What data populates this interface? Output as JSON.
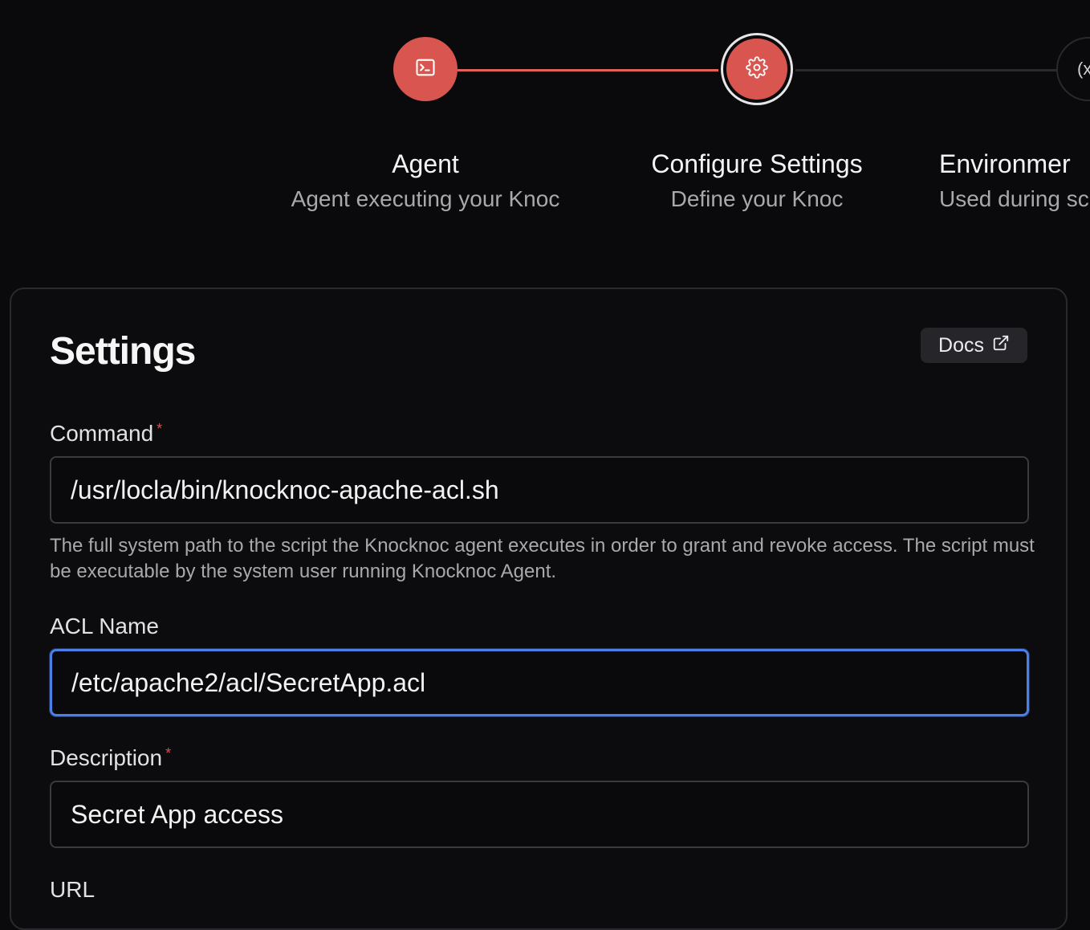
{
  "stepper": {
    "steps": [
      {
        "title": "Agent",
        "subtitle": "Agent executing your Knoc",
        "icon": "terminal-icon",
        "state": "completed"
      },
      {
        "title": "Configure Settings",
        "subtitle": "Define your Knoc",
        "icon": "gear-icon",
        "state": "current"
      },
      {
        "title": "Environmer",
        "subtitle": "Used during sc",
        "icon": "variable-icon",
        "icon_text": "(x",
        "state": "upcoming"
      }
    ]
  },
  "settings": {
    "title": "Settings",
    "docs_label": "Docs",
    "fields": {
      "command": {
        "label": "Command",
        "required_mark": "*",
        "value": "/usr/locla/bin/knocknoc-apache-acl.sh",
        "help": "The full system path to the script the Knocknoc agent executes in order to grant and revoke access. The script must be executable by the system user running Knocknoc Agent."
      },
      "acl_name": {
        "label": "ACL Name",
        "value": "/etc/apache2/acl/SecretApp.acl"
      },
      "description": {
        "label": "Description",
        "required_mark": "*",
        "value": "Secret App access"
      },
      "url": {
        "label": "URL"
      }
    }
  },
  "colors": {
    "accent": "#d8564f",
    "focus": "#4a7fe8",
    "background": "#0a0a0c"
  }
}
